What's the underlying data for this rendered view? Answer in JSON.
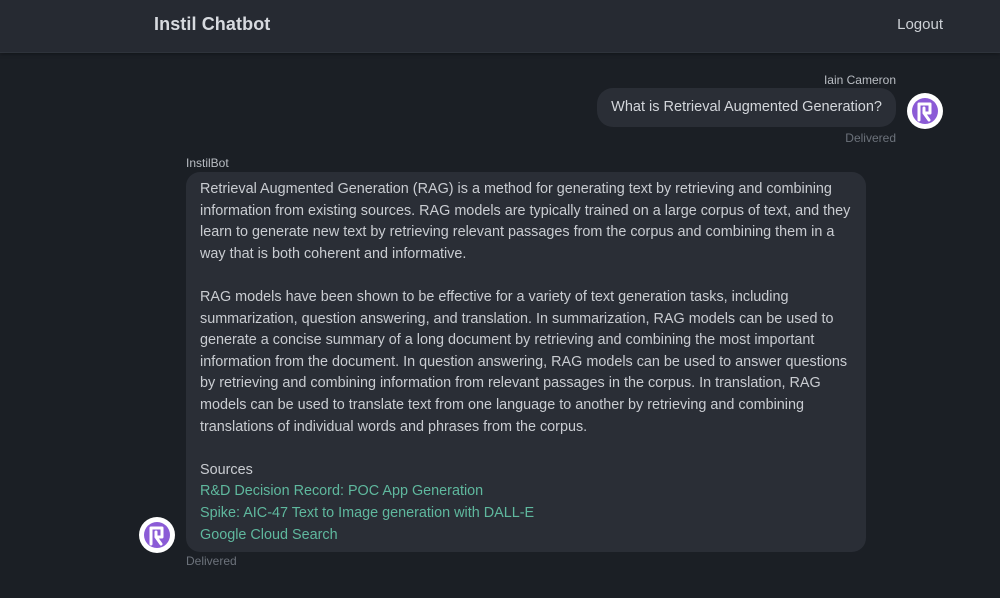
{
  "header": {
    "title": "Instil Chatbot",
    "logout_label": "Logout"
  },
  "conversation": {
    "user_message": {
      "sender": "Iain Cameron",
      "text": "What is Retrieval Augmented Generation?",
      "status": "Delivered"
    },
    "bot_message": {
      "sender": "InstilBot",
      "paragraph_1": " Retrieval Augmented Generation (RAG) is a method for generating text by retrieving and combining information from existing sources. RAG models are typically trained on a large corpus of text, and they learn to generate new text by retrieving relevant passages from the corpus and combining them in a way that is both coherent and informative.",
      "paragraph_2": "RAG models have been shown to be effective for a variety of text generation tasks, including summarization, question answering, and translation. In summarization, RAG models can be used to generate a concise summary of a long document by retrieving and combining the most important information from the document. In question answering, RAG models can be used to answer questions by retrieving and combining information from relevant passages in the corpus. In translation, RAG models can be used to translate text from one language to another by retrieving and combining translations of individual words and phrases from the corpus.",
      "sources_label": "Sources",
      "sources": [
        "R&D Decision Record: POC App Generation",
        "Spike: AIC-47 Text to Image generation with DALL-E",
        "Google Cloud Search"
      ],
      "status": "Delivered"
    }
  },
  "colors": {
    "background": "#1b1f25",
    "navbar": "#262a32",
    "bubble": "#2a2e36",
    "link": "#5fb89e",
    "avatar_accent": "#8b5bd6"
  },
  "icons": {
    "avatar": "instil-logo-icon"
  }
}
